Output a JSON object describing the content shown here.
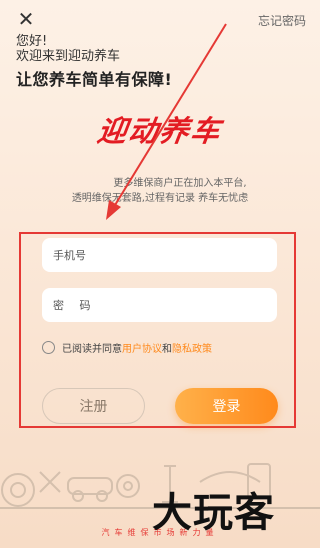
{
  "header": {
    "close_icon": "close-icon",
    "forgot_password": "忘记密码"
  },
  "greeting": {
    "line1": "您好!",
    "line2": "欢迎来到迎动养车",
    "line3": "让您养车简单有保障!"
  },
  "logo_text": "迎动养车",
  "description": {
    "line1": "更多维保商户正在加入本平台,",
    "line2": "透明维保无套路,过程有记录 养车无忧虑"
  },
  "form": {
    "phone_placeholder": "手机号",
    "password_placeholder": "密 码",
    "agree_prefix": "已阅读并同意",
    "user_agreement": "用户协议",
    "and": "和",
    "privacy_policy": "隐私政策",
    "register_label": "注册",
    "login_label": "登录"
  },
  "footer": {
    "slogan": "汽车维保市场新力量",
    "watermark": "大玩客"
  },
  "colors": {
    "accent_orange": "#ff8a1c",
    "brand_red": "#e31c23",
    "annotation_red": "#e53935"
  }
}
